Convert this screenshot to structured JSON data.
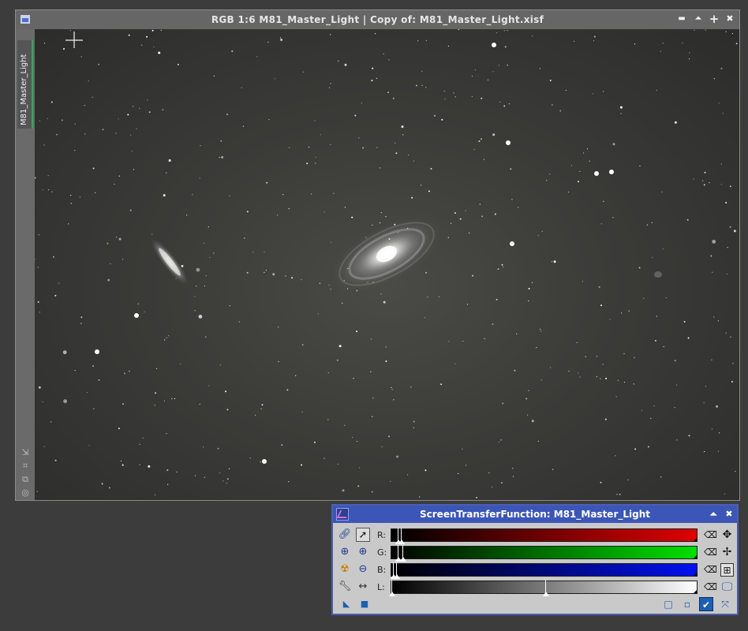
{
  "image_window": {
    "title": "RGB 1:6 M81_Master_Light | Copy of: M81_Master_Light.xisf",
    "view_tab_label": "M81_Master_Light",
    "controls": {
      "minimize": "▬",
      "shade": "⏶",
      "maximize": "+",
      "close": "✖"
    },
    "side_tools": [
      "⇲",
      "⌗",
      "⧉",
      "◎"
    ]
  },
  "stf_panel": {
    "title": "ScreenTransferFunction: M81_Master_Light",
    "controls": {
      "shade": "⏶",
      "close": "✖"
    },
    "channels": [
      {
        "label": "R:",
        "color": "#e00000",
        "midtone": 0.03,
        "shadows": 0.02
      },
      {
        "label": "G:",
        "color": "#00e000",
        "midtone": 0.035,
        "shadows": 0.02
      },
      {
        "label": "B:",
        "color": "#0010ee",
        "midtone": 0.015,
        "shadows": 0.005
      },
      {
        "label": "L:",
        "color": "#ffffff",
        "midtone": 0.5,
        "shadows": 0.0
      }
    ],
    "reset_glyph": "⌫",
    "colors": {
      "titlebar": "#3c56b7",
      "panel": "#c9c9c9",
      "accent": "#1d5fb0"
    }
  }
}
